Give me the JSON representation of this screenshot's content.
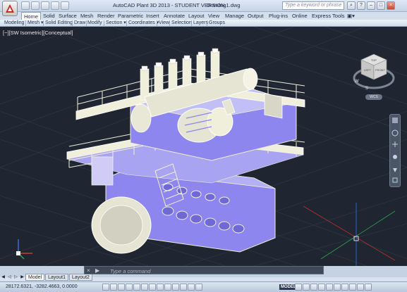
{
  "window": {
    "title": "AutoCAD Plant 3D 2013 - STUDENT VERSION",
    "filename": "Drawing1.dwg",
    "search_placeholder": "Type a keyword or phrase"
  },
  "ribbon_tabs": [
    "Home",
    "Solid",
    "Surface",
    "Mesh",
    "Render",
    "Parametric",
    "Insert",
    "Annotate",
    "Layout",
    "View",
    "Manage",
    "Output",
    "Plug-ins",
    "Online",
    "Express Tools"
  ],
  "ribbon_tab_extra": "▣▾",
  "panels": [
    "Modeling",
    "Mesh ▾",
    "Solid Editing",
    "Draw",
    "Modify",
    "Section ▾",
    "Coordinates ▾",
    "View",
    "Selection",
    "Layers",
    "Groups"
  ],
  "viewport": {
    "label": "[−][SW Isometric][Conceptual]",
    "viewcube_faces": [
      "TOP",
      "LEFT",
      "FRONT"
    ],
    "compass": [
      "S",
      "W"
    ],
    "wcs_label": "WCS"
  },
  "command_line": {
    "placeholder": "Type a command"
  },
  "layout_tabs": [
    "Model",
    "Layout1",
    "Layout2"
  ],
  "status": {
    "coordinates": "28172.6321, -3282.4663, 0.0000",
    "model_label": "MODEL"
  },
  "colors": {
    "viewport_bg": "#1f2631",
    "model_body": "#8c86ee",
    "model_light": "#f0efdc"
  }
}
